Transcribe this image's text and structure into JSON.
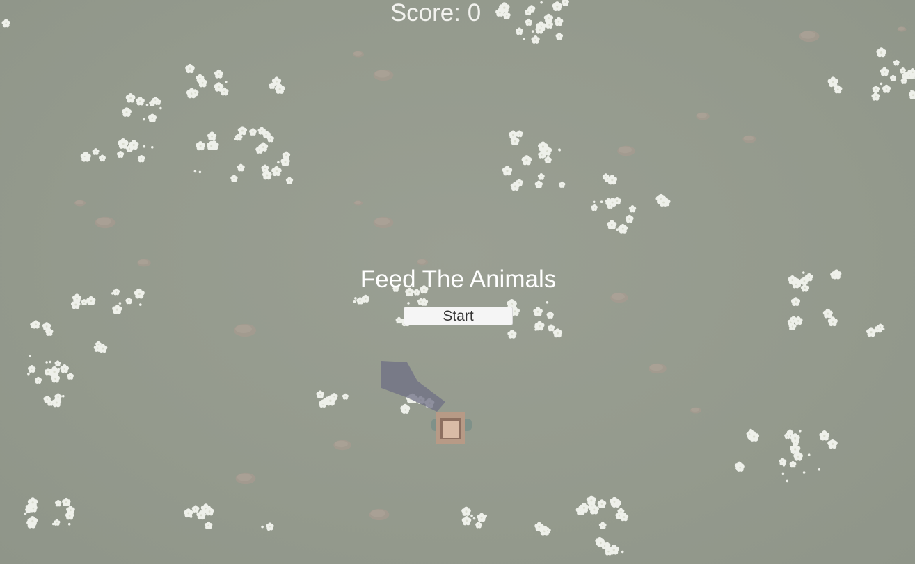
{
  "hud": {
    "score_label": "Score: 0"
  },
  "menu": {
    "title": "Feed The Animals",
    "start_label": "Start"
  },
  "scene": {
    "ground_color": "#959a8e",
    "flower_color": "#eef0ea",
    "stone_color": "#a89a8f",
    "player_color": "#c9a58c",
    "player_shadow_color": "#6f7085",
    "objects": [
      "ground",
      "white-flower-clusters",
      "pebbles",
      "player-farmer"
    ]
  }
}
